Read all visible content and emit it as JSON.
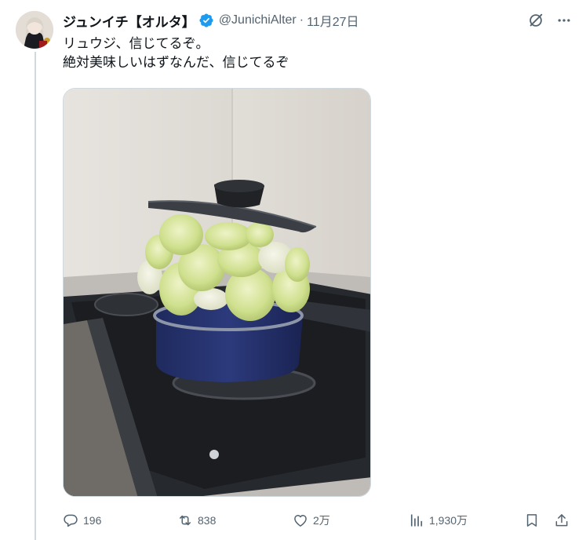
{
  "tweet": {
    "author_name": "ジュンイチ【オルタ】",
    "handle": "@JunichiAlter",
    "separator": "·",
    "date": "11月27日",
    "lines": [
      "リュウジ、信じてるぞ。",
      "絶対美味しいはずなんだ、信じてるぞ"
    ]
  },
  "actions": {
    "replies": "196",
    "reposts": "838",
    "likes": "2万",
    "views": "1,930万"
  },
  "icons": [
    "avatar",
    "verified-badge-icon",
    "grok-icon",
    "more-icon",
    "reply-icon",
    "repost-icon",
    "like-icon",
    "views-icon",
    "bookmark-icon",
    "share-icon"
  ],
  "colors": {
    "verified": "#1d9bf0",
    "secondary_text": "#536471",
    "thread_line": "#cfd9de"
  }
}
